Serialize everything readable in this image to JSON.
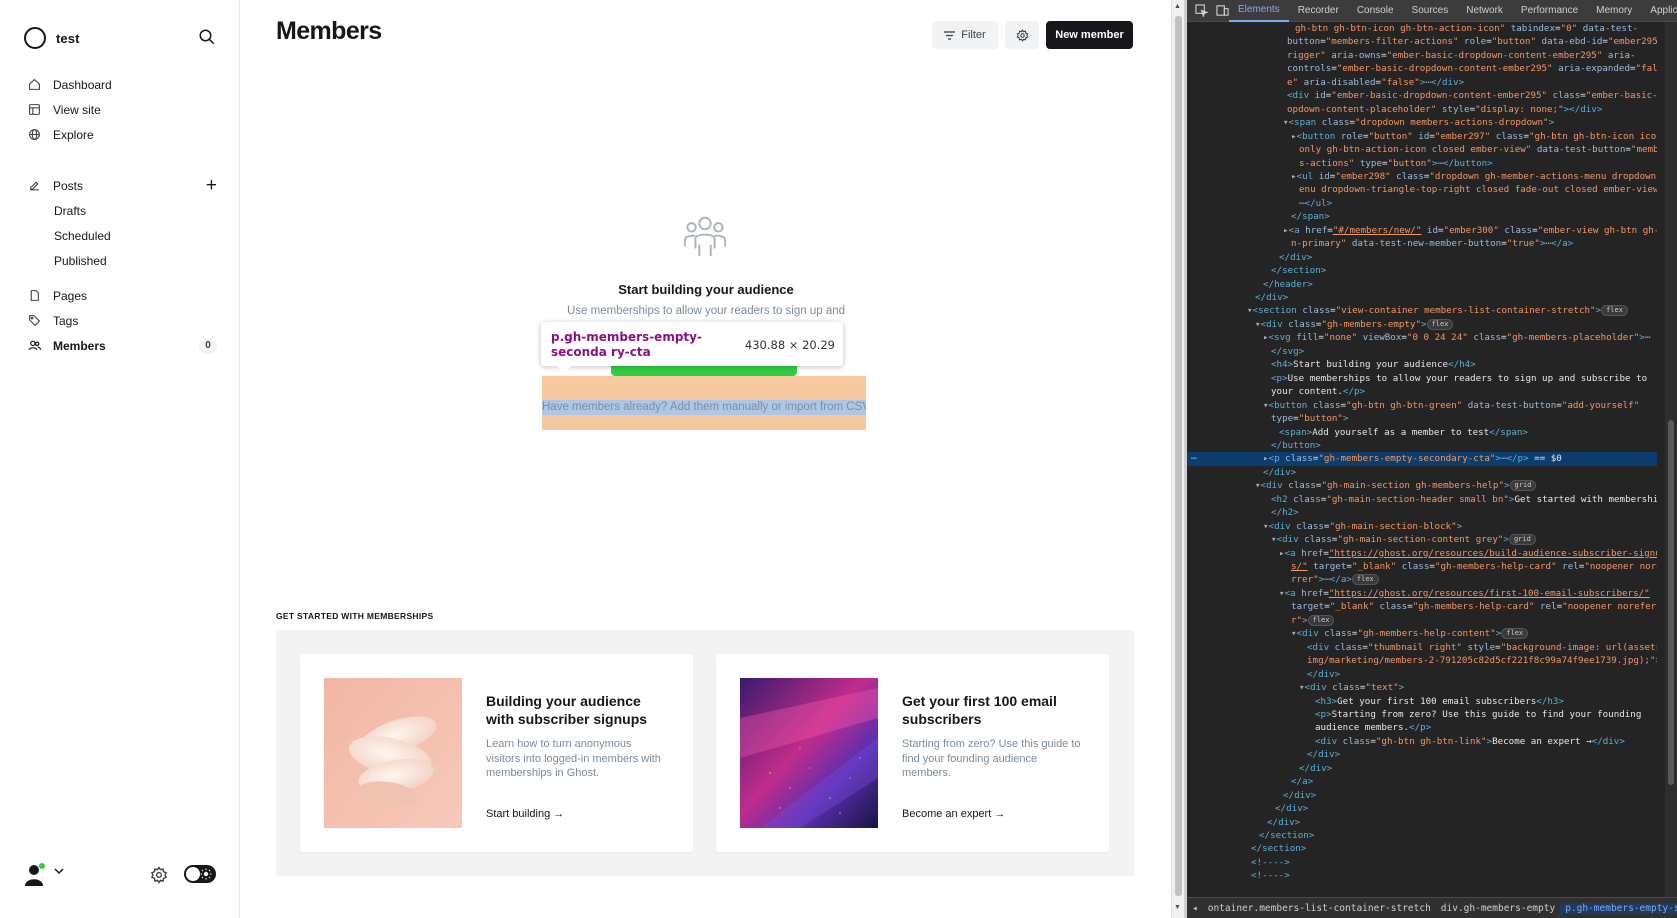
{
  "sidebar": {
    "site_name": "test",
    "nav": [
      {
        "label": "Dashboard",
        "icon": "home-icon"
      },
      {
        "label": "View site",
        "icon": "layout-icon"
      },
      {
        "label": "Explore",
        "icon": "globe-icon"
      }
    ],
    "posts": {
      "label": "Posts",
      "sub": [
        "Drafts",
        "Scheduled",
        "Published"
      ]
    },
    "pages_label": "Pages",
    "tags_label": "Tags",
    "members_label": "Members",
    "members_count": "0"
  },
  "header": {
    "title": "Members",
    "filter_label": "Filter",
    "new_member_label": "New member"
  },
  "empty_state": {
    "title": "Start building your audience",
    "description": "Use memberships to allow your readers to sign up and",
    "secondary_cta": "Have members already? Add them manually or import from CSV"
  },
  "inspect_tooltip": {
    "selector": "p.gh-members-empty-seconda ry-cta",
    "size": "430.88 × 20.29"
  },
  "help": {
    "header": "GET STARTED WITH MEMBERSHIPS",
    "cards": [
      {
        "title": "Building your audience with subscriber signups",
        "description": "Learn how to turn anonymous visitors into logged-in members with memberships in Ghost.",
        "link": "Start building →"
      },
      {
        "title": "Get your first 100 email subscribers",
        "description": "Starting from zero? Use this guide to find your founding audience members.",
        "link": "Become an expert →"
      }
    ]
  },
  "devtools": {
    "tabs": [
      "Elements",
      "Recorder",
      "Console",
      "Sources",
      "Network",
      "Performance",
      "Memory",
      "Applic"
    ],
    "active_tab": "Elements",
    "breadcrumbs": [
      "ontainer.members-list-container-stretch",
      "div.gh-members-empty",
      "p.gh-members-empty-secondary-cta"
    ]
  },
  "colors": {
    "accent_green": "#30cf43",
    "primary_dark": "#15171a",
    "devtools_bg": "#242424",
    "highlight_content": "#abc6e6",
    "highlight_margin": "#f6c79c"
  }
}
